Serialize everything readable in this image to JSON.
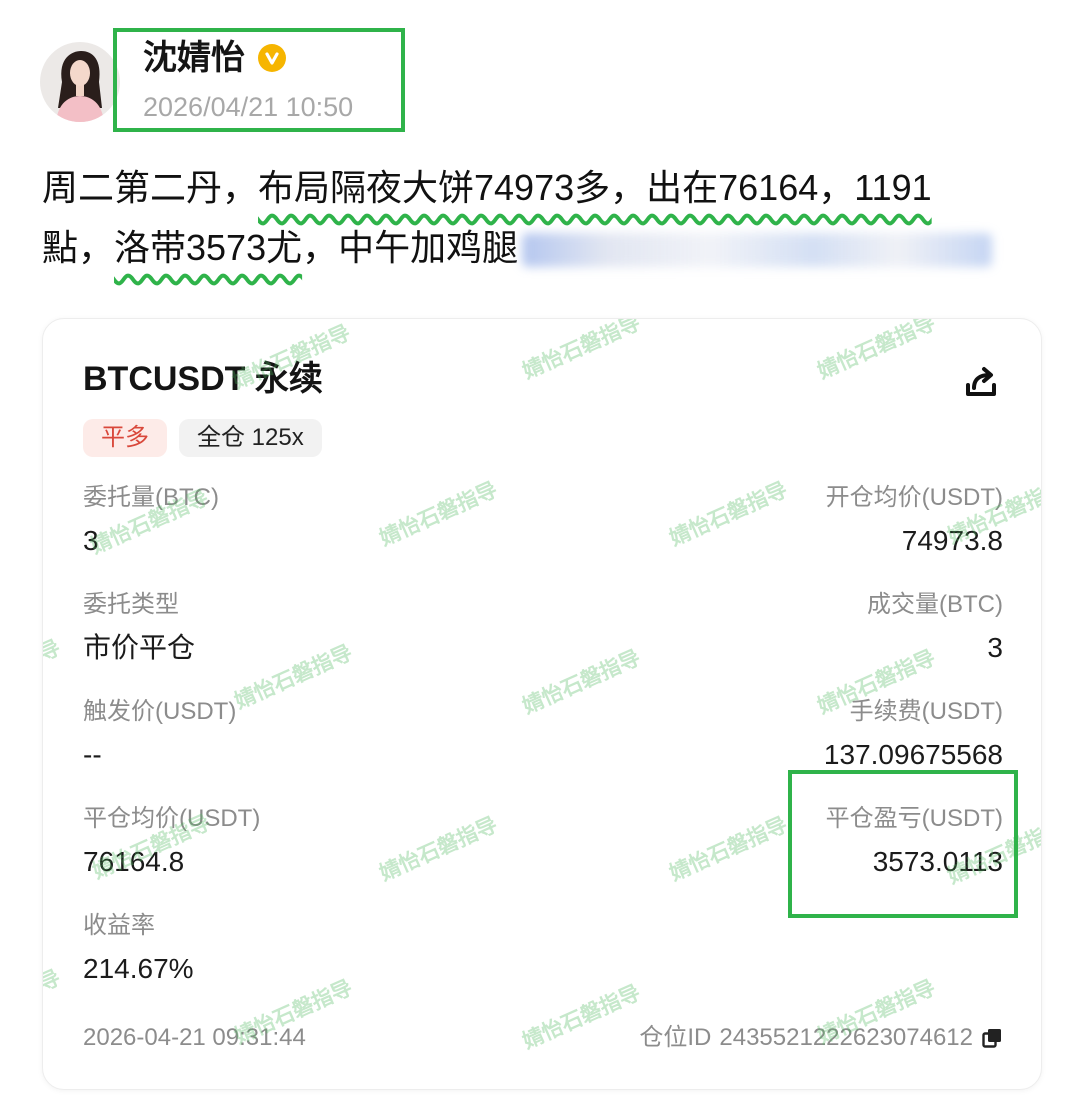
{
  "author": {
    "name": "沈婧怡",
    "timestamp": "2026/04/21 10:50",
    "badge_icon": "verified-badge-icon",
    "avatar": "avatar-photo"
  },
  "post": {
    "line1_plain": "周二第二丹，",
    "line1_marked": "布局隔夜大饼74973多，出在76164，1191",
    "line2_plain": "點，",
    "line2_marked": "洛带3573尤",
    "line2_tail": "，中午加鸡腿"
  },
  "card": {
    "title": "BTCUSDT 永续",
    "share_icon": "share-icon",
    "tag_side": "平多",
    "tag_margin": "全仓 125x",
    "rows": [
      {
        "left": {
          "label": "委托量(BTC)",
          "value": "3"
        },
        "right": {
          "label": "开仓均价(USDT)",
          "value": "74973.8"
        }
      },
      {
        "left": {
          "label": "委托类型",
          "value": "市价平仓"
        },
        "right": {
          "label": "成交量(BTC)",
          "value": "3"
        }
      },
      {
        "left": {
          "label": "触发价(USDT)",
          "value": "--"
        },
        "right": {
          "label": "手续费(USDT)",
          "value": "137.09675568"
        }
      },
      {
        "left": {
          "label": "平仓均价(USDT)",
          "value": "76164.8"
        },
        "right": {
          "label": "平仓盈亏(USDT)",
          "value": "3573.0113"
        }
      },
      {
        "left": {
          "label": "收益率",
          "value": "214.67%"
        }
      }
    ],
    "footer": {
      "time": "2026-04-21 09:31:44",
      "position_id_label": "仓位ID",
      "position_id": "2435521222623074612",
      "copy_icon": "copy-icon"
    }
  },
  "watermark": {
    "text": "婧怡石磐指导"
  },
  "colors": {
    "annotation_green": "#2fb34a",
    "tag_side_text": "#d9483b",
    "tag_side_bg": "#fdebe8",
    "tag_margin_bg": "#f2f2f2",
    "label_gray": "#8c8c8c",
    "watermark_green": "#50b95f",
    "badge_gold": "#f6b500"
  }
}
